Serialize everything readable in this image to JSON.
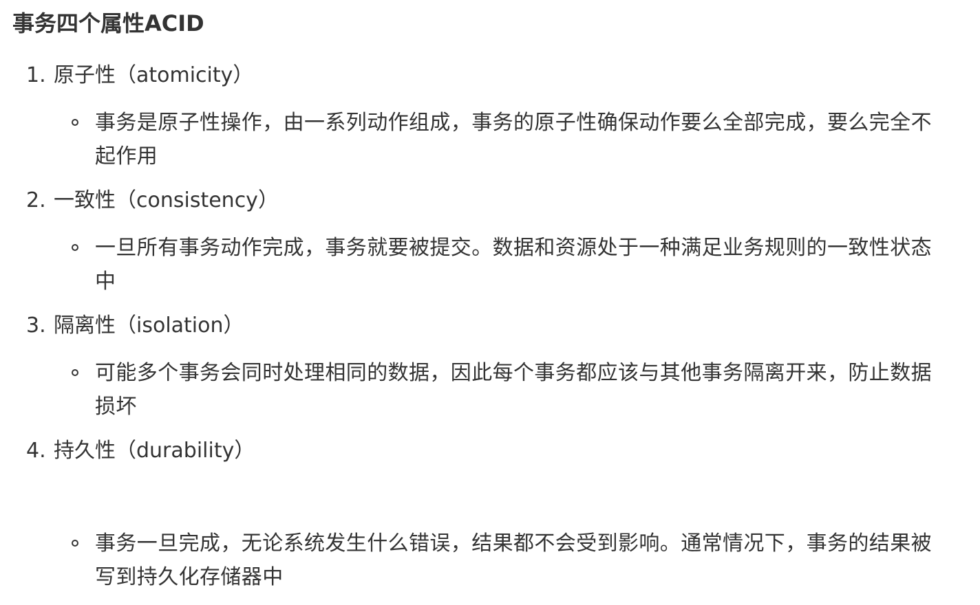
{
  "title": "事务四个属性ACID",
  "items": [
    {
      "number": "1.",
      "heading": "原子性（atomicity）",
      "detail": "事务是原子性操作，由一系列动作组成，事务的原子性确保动作要么全部完成，要么完全不起作用"
    },
    {
      "number": "2.",
      "heading": "一致性（consistency）",
      "detail": "一旦所有事务动作完成，事务就要被提交。数据和资源处于一种满足业务规则的一致性状态中"
    },
    {
      "number": "3.",
      "heading": "隔离性（isolation）",
      "detail": "可能多个事务会同时处理相同的数据，因此每个事务都应该与其他事务隔离开来，防止数据损坏"
    },
    {
      "number": "4.",
      "heading": "持久性（durability）",
      "detail": "事务一旦完成，无论系统发生什么错误，结果都不会受到影响。通常情况下，事务的结果被写到持久化存储器中"
    }
  ]
}
